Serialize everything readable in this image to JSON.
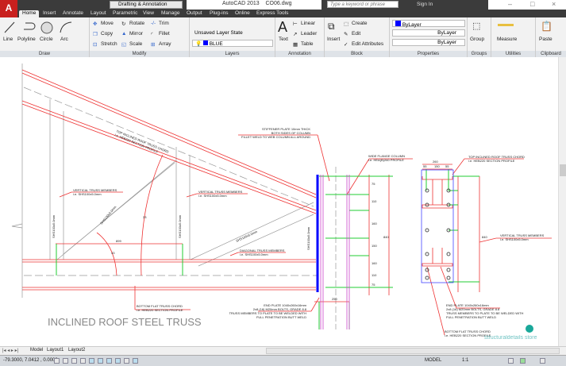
{
  "app": {
    "logo": "A",
    "workspace": "Drafting & Annotation",
    "title": "AutoCAD 2013",
    "filename": "CO06.dwg",
    "search_placeholder": "Type a keyword or phrase",
    "sign_in": "Sign In"
  },
  "tabs": [
    "Home",
    "Insert",
    "Annotate",
    "Layout",
    "Parametric",
    "View",
    "Manage",
    "Output",
    "Plug-ins",
    "Online",
    "Express Tools"
  ],
  "ribbon": {
    "draw": {
      "label": "Draw",
      "items": [
        "Line",
        "Polyline",
        "Circle",
        "Arc"
      ]
    },
    "modify": {
      "label": "Modify",
      "items": [
        "Move",
        "Rotate",
        "Trim",
        "Copy",
        "Mirror",
        "Fillet",
        "Stretch",
        "Scale",
        "Array"
      ]
    },
    "layers": {
      "label": "Layers",
      "layer_state": "Unsaved Layer State",
      "current_layer": "BLUE"
    },
    "annotation": {
      "label": "Annotation",
      "items": [
        "Text",
        "Linear",
        "Leader",
        "Table"
      ]
    },
    "block": {
      "label": "Block",
      "items": [
        "Insert",
        "Create",
        "Edit",
        "Edit Attributes"
      ]
    },
    "properties": {
      "label": "Properties",
      "color": "ByLayer",
      "linetype": "ByLayer",
      "lineweight": "ByLayer"
    },
    "groups": {
      "label": "Groups",
      "item": "Group"
    },
    "utilities": {
      "label": "Utilities",
      "item": "Measure"
    },
    "clipboard": {
      "label": "Clipboard",
      "item": "Paste"
    }
  },
  "drawing": {
    "title": "INCLINED ROOF STEEL TRUSS",
    "top_chord": [
      "TOP INCLINED ROOF TRUSS CHORD",
      "i.e. HEB220 SECTION PROFILE"
    ],
    "vertical1": [
      "VERTICAL TRUSS MEMBERS",
      "i.e. SHS100x5.0mm"
    ],
    "vertical2": [
      "VERTICAL TRUSS MEMBERS",
      "i.e. SHS100x5.0mm"
    ],
    "diagonal": [
      "DIAGONAL TRUSS MEMBERS",
      "i.e. SHS100x5.0mm"
    ],
    "bottom_chord": [
      "BOTTOM FLAT TRUSS CHORD",
      "i.e. HEB220 SECTION PROFILE"
    ],
    "stiffener": [
      "STIFFENER PLATE 10mm THICK",
      "BOTH SIDES OF COLUMN",
      "FILLET WELD TO WEB COLUMN ALL AROUND"
    ],
    "column": [
      "WIDE FLANGE COLUMN",
      "i.e. HEA(B)260 PROFILE"
    ],
    "end_plate": [
      "END PLATE 1040x260x16mm",
      "2x8 (16) M20mm BOLTS, GRADE 8.8",
      "TRUSS MEMBERS TO PLATE TO BE WELDED WITH",
      "FULL PENETRATION BUTT WELD"
    ],
    "right_top_chord": [
      "TOP INCLINED ROOF TRUSS CHORD",
      "i.e. HEB220 SECTION PROFILE"
    ],
    "right_vertical": [
      "VERTICAL TRUSS MEMBERS",
      "i.e. SHS100x5.0mm"
    ],
    "right_end_plate": [
      "END PLATE 1040x260x16mm",
      "2x8 (16) M20mm BOLTS, GRADE 8.8",
      "TRUSS MEMBERS TO PLATE TO BE WELDED WITH",
      "FULL PENETRATION BUTT WELD"
    ],
    "right_bottom_chord": [
      "BOTTOM FLAT TRUSS CHORD",
      "i.e. HEB220 SECTION PROFILE"
    ],
    "member_tags": [
      "SHS100x5.0mm",
      "SHS100x5.0mm",
      "SHS100x5.0mm",
      "SHS100x5.0mm",
      "SHS100x5.0mm"
    ],
    "dims": {
      "span": "899",
      "angle1": "33",
      "angle2": "43",
      "d75a": "75",
      "d110": "110",
      "d160a": "160",
      "d150": "150",
      "d160b": "160",
      "d110b": "110",
      "d75b": "75",
      "total": "840",
      "width": "250",
      "pw": "260",
      "e1": "55",
      "e2": "150",
      "e3": "55",
      "rtotal": "840"
    },
    "watermark": "structuraldetails store"
  },
  "layout_tabs": [
    "Model",
    "Layout1",
    "Layout2"
  ],
  "status": {
    "coords": "-79.3000, 7.0412 , 0.0000",
    "model": "MODEL",
    "scale": "1:1"
  }
}
